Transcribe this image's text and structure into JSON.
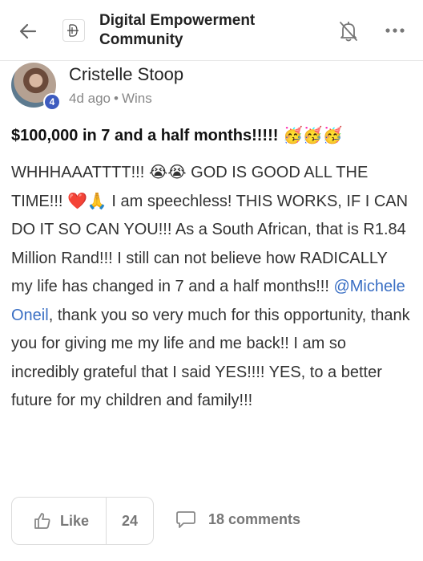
{
  "header": {
    "community_name": "Digital Empowerment Community",
    "back_icon": "arrow-left-icon",
    "bell_icon": "bell-off-icon",
    "more_icon": "more-horizontal-icon"
  },
  "post": {
    "author": "Cristelle Stoop",
    "level": "4",
    "time_ago": "4d ago",
    "category": "Wins",
    "title": "$100,000 in 7 and a half months!!!!! 🥳🥳🥳",
    "body_part1": "WHHHAAATTTT!!! 😭😭 GOD IS GOOD ALL THE TIME!!! ❤️🙏 I am speechless! THIS WORKS, IF I CAN DO IT SO CAN YOU!!! As a South African, that is R1.84 Million Rand!!! I still can not believe how RADICALLY my life has changed in 7 and a half months!!! ",
    "mention": "@Michele Oneil",
    "body_part2": ", thank you so very much for this opportunity, thank you for giving me my life and me back!! I am so incredibly grateful that I said YES!!!! YES, to a better future for my children and family!!!"
  },
  "actions": {
    "like_label": "Like",
    "like_count": "24",
    "comments_label": "18 comments"
  },
  "colors": {
    "mention": "#3a6fc4",
    "badge": "#3d5bbf",
    "muted": "#777777"
  }
}
